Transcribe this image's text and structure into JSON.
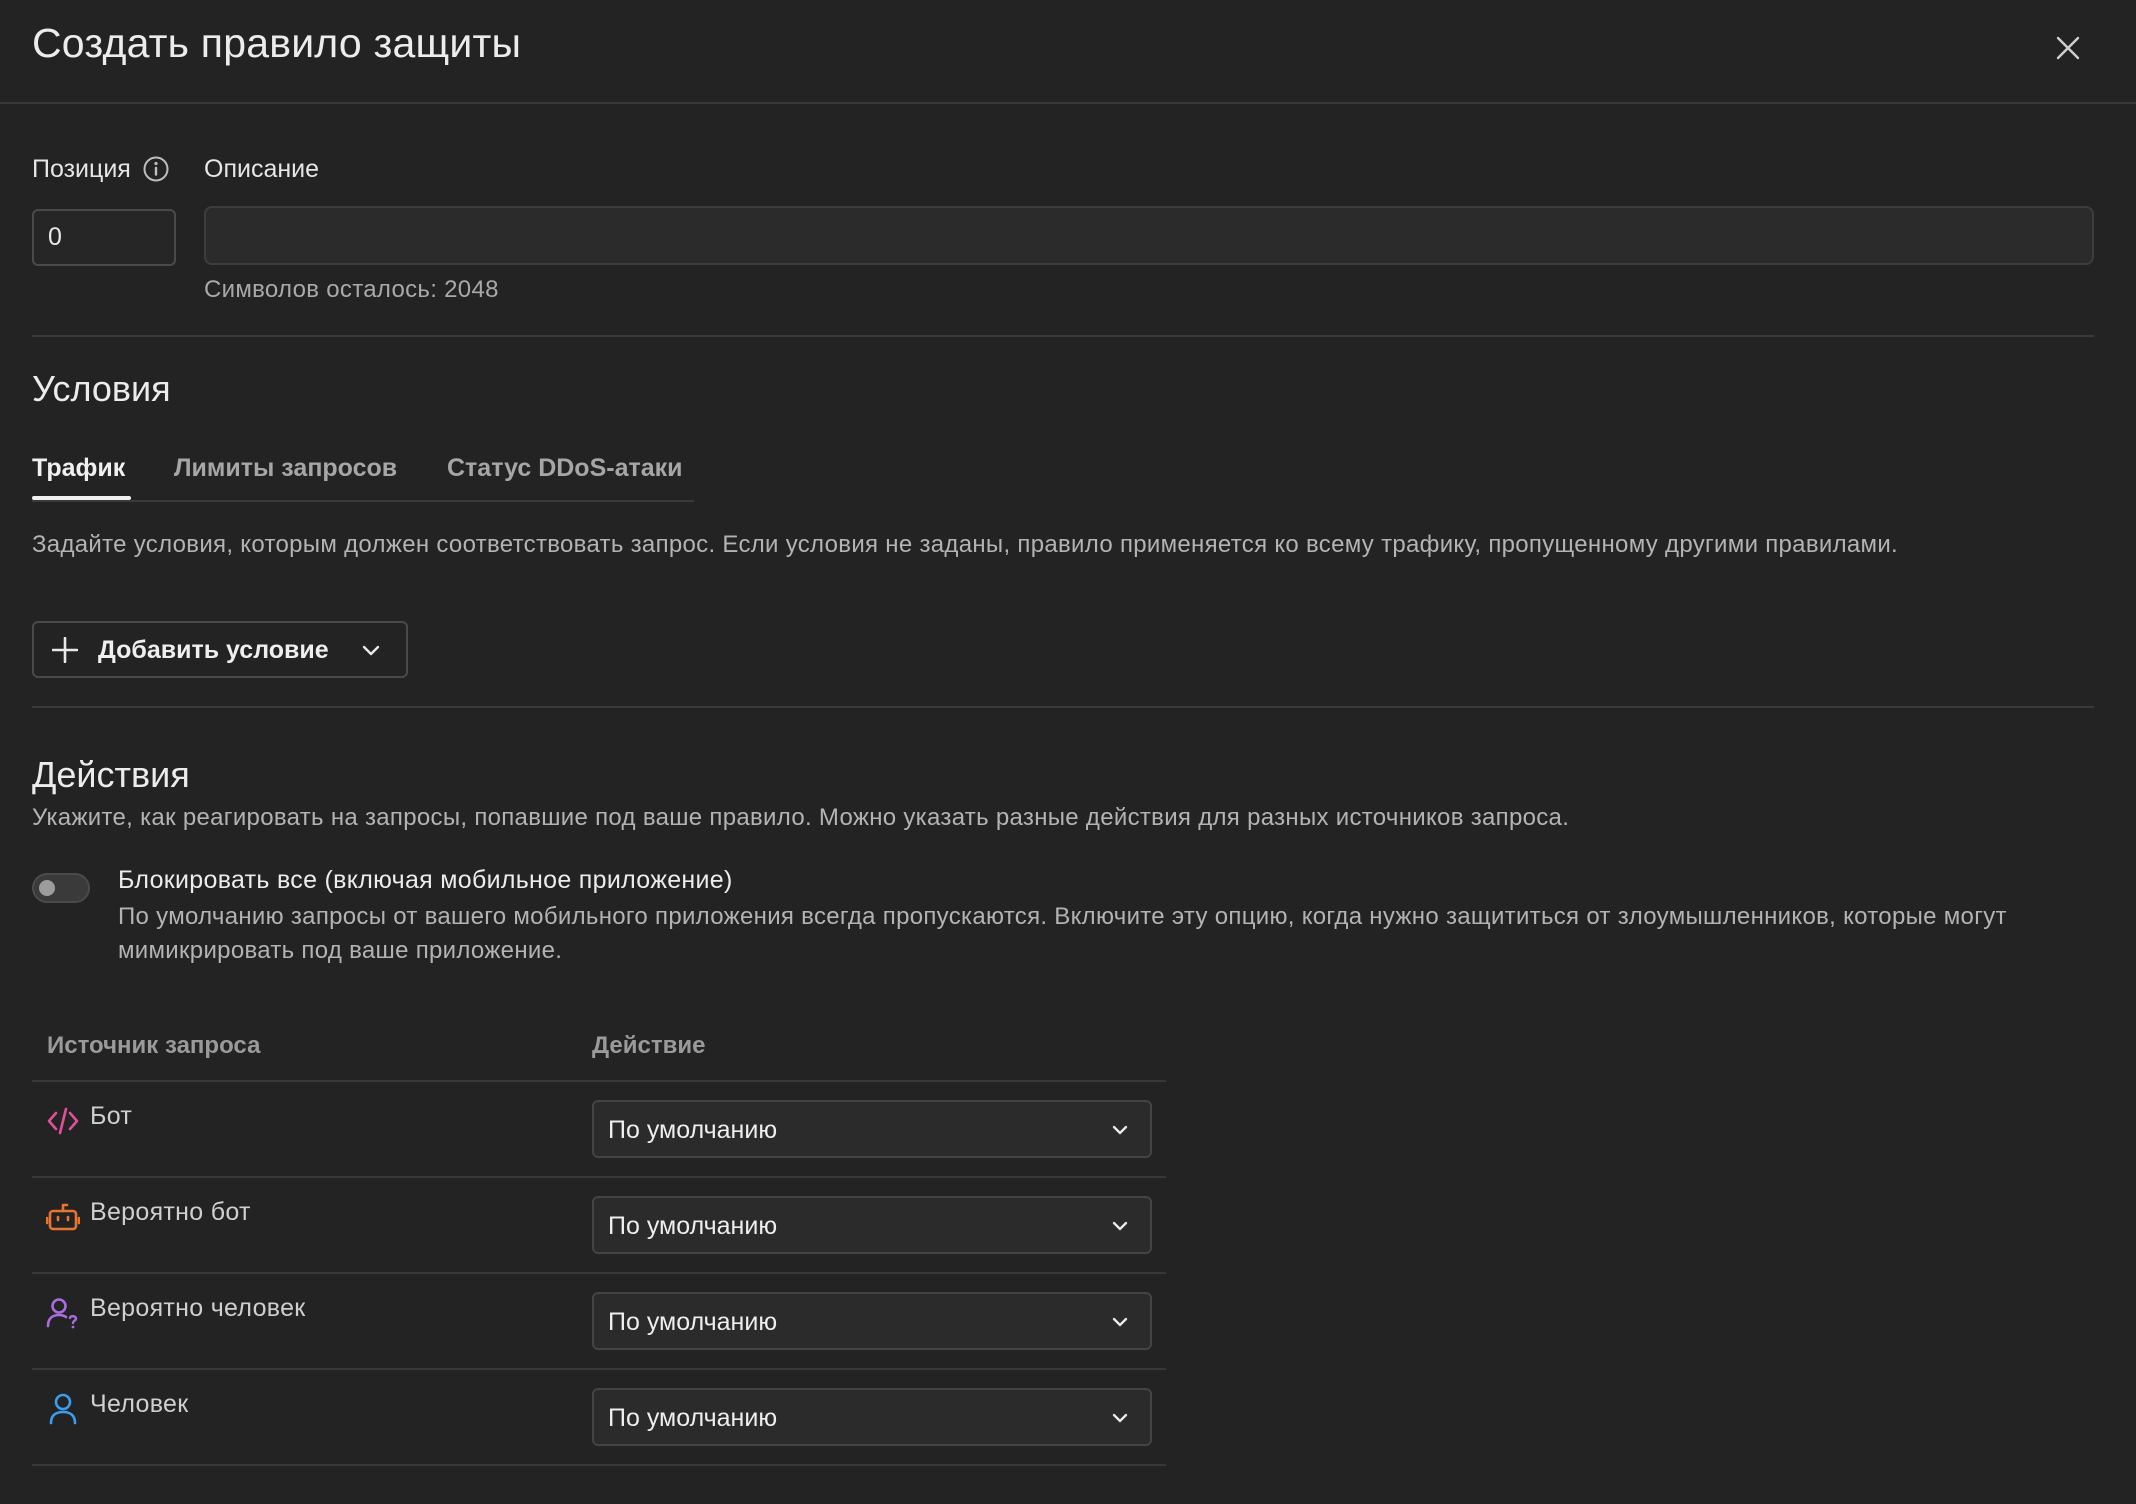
{
  "dialog": {
    "title": "Создать правило защиты"
  },
  "position": {
    "label": "Позиция",
    "value": "0"
  },
  "description": {
    "label": "Описание",
    "value": "",
    "chars_left": "Символов осталось: 2048"
  },
  "conditions": {
    "title": "Условия",
    "tabs": [
      {
        "label": "Трафик",
        "active": true
      },
      {
        "label": "Лимиты запросов",
        "active": false
      },
      {
        "label": "Статус DDoS-атаки",
        "active": false
      }
    ],
    "help": "Задайте условия, которым должен соответствовать запрос. Если условия не заданы, правило применяется ко всему трафику, пропущенному другими правилами.",
    "add_button": "Добавить условие"
  },
  "actions": {
    "title": "Действия",
    "help": "Укажите, как реагировать на запросы, попавшие под ваше правило. Можно указать разные действия для разных источников запроса.",
    "block_all": {
      "label": "Блокировать все (включая мобильное приложение)",
      "description": "По умолчанию запросы от вашего мобильного приложения всегда пропускаются. Включите эту опцию, когда нужно защититься от злоумышленников, которые могут мимикрировать под ваше приложение.",
      "enabled": false
    },
    "table": {
      "headers": [
        "Источник запроса",
        "Действие"
      ],
      "rows": [
        {
          "source": "Бот",
          "icon": "code-icon",
          "action": "По умолчанию"
        },
        {
          "source": "Вероятно бот",
          "icon": "robot-icon",
          "action": "По умолчанию"
        },
        {
          "source": "Вероятно человек",
          "icon": "user-question-icon",
          "action": "По умолчанию"
        },
        {
          "source": "Человек",
          "icon": "user-icon",
          "action": "По умолчанию"
        }
      ]
    }
  },
  "colors": {
    "background": "#232323",
    "bot_icon": "#e0509a",
    "probably_bot_icon": "#e8742e",
    "probably_human_icon": "#a86ee0",
    "human_icon": "#3a9ef0"
  }
}
